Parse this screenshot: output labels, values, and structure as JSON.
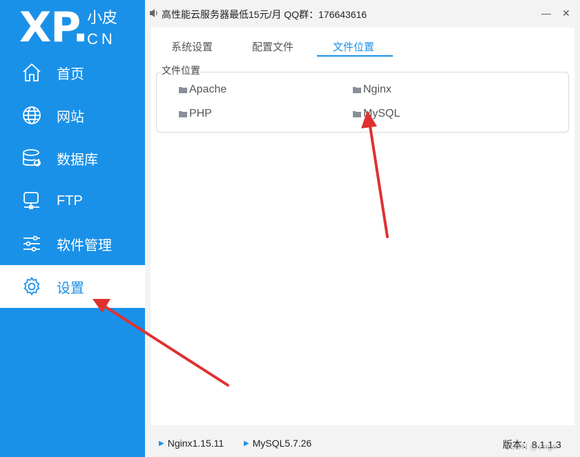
{
  "logo": {
    "main": "XP.",
    "cn": "小皮",
    "en": "CN"
  },
  "sidebar": {
    "items": [
      {
        "label": "首页",
        "icon": "home-icon"
      },
      {
        "label": "网站",
        "icon": "globe-icon"
      },
      {
        "label": "数据库",
        "icon": "database-icon"
      },
      {
        "label": "FTP",
        "icon": "monitor-icon"
      },
      {
        "label": "软件管理",
        "icon": "sliders-icon"
      },
      {
        "label": "设置",
        "icon": "gear-icon",
        "active": true
      }
    ]
  },
  "titlebar": {
    "text": "高性能云服务器最低15元/月  QQ群：176643616",
    "minimize": "—",
    "close": "✕"
  },
  "tabs": [
    {
      "label": "系统设置"
    },
    {
      "label": "配置文件"
    },
    {
      "label": "文件位置",
      "active": true
    }
  ],
  "file_locations": {
    "group_label": "文件位置",
    "items": [
      "Apache",
      "Nginx",
      "PHP",
      "MySQL"
    ]
  },
  "status": {
    "services": [
      "Nginx1.15.11",
      "MySQL5.7.26"
    ],
    "version": "版本：8.1.1.3",
    "watermark": "CSDN @ongri"
  },
  "colors": {
    "accent": "#1a91e8",
    "annotation": "#e03030"
  }
}
